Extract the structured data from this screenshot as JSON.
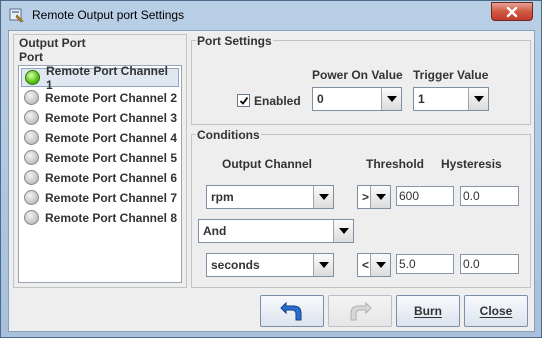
{
  "window": {
    "title": "Remote Output port Settings"
  },
  "output_port": {
    "group_title": "Output Port",
    "list_header": "Port",
    "items": [
      {
        "label": "Remote Port Channel 1",
        "active": true
      },
      {
        "label": "Remote Port Channel 2",
        "active": false
      },
      {
        "label": "Remote Port Channel 3",
        "active": false
      },
      {
        "label": "Remote Port Channel 4",
        "active": false
      },
      {
        "label": "Remote Port Channel 5",
        "active": false
      },
      {
        "label": "Remote Port Channel 6",
        "active": false
      },
      {
        "label": "Remote Port Channel 7",
        "active": false
      },
      {
        "label": "Remote Port Channel 8",
        "active": false
      }
    ]
  },
  "port_settings": {
    "group_title": "Port Settings",
    "enabled_label": "Enabled",
    "enabled_checked": true,
    "power_on_label": "Power On Value",
    "power_on_value": "0",
    "trigger_label": "Trigger Value",
    "trigger_value": "1"
  },
  "conditions": {
    "group_title": "Conditions",
    "col_output_channel": "Output Channel",
    "col_threshold": "Threshold",
    "col_hysteresis": "Hysteresis",
    "row1": {
      "channel": "rpm",
      "operator": ">",
      "threshold": "600",
      "hysteresis": "0.0"
    },
    "logic": "And",
    "row2": {
      "channel": "seconds",
      "operator": "<",
      "threshold": "5.0",
      "hysteresis": "0.0"
    }
  },
  "buttons": {
    "burn": "Burn",
    "close": "Close"
  }
}
